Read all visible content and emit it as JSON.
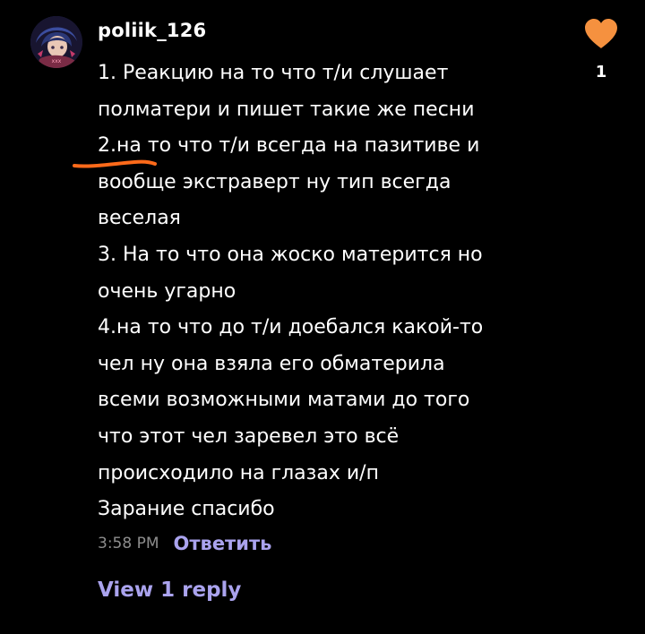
{
  "comment": {
    "username": "poliik_126",
    "lines": [
      "1. Реакцию на то что т/и слушает",
      "полматери и пишет такие же песни",
      "2.на то что т/и всегда на пазитиве и",
      "вообще экстраверт ну тип всегда",
      "веселая",
      "3. На то что она жоско матерится но",
      "очень угарно",
      "4.на то что до т/и доебался какой-то",
      "чел ну она взяла его обматерила",
      "всеми возможными матами до того",
      "что этот чел заревел это всё",
      "происходило на глазах и/п",
      "Зарание спасибо"
    ],
    "time": "3:58 PM",
    "reply_label": "Ответить",
    "view_replies_label": "View 1 reply",
    "like_count": "1",
    "heart_icon": "heart-icon",
    "colors": {
      "background": "#000000",
      "accent": "#aaa3ee",
      "heart": "#f5913f",
      "annotation": "#ff6a1a",
      "muted": "#8d8d8d"
    }
  }
}
